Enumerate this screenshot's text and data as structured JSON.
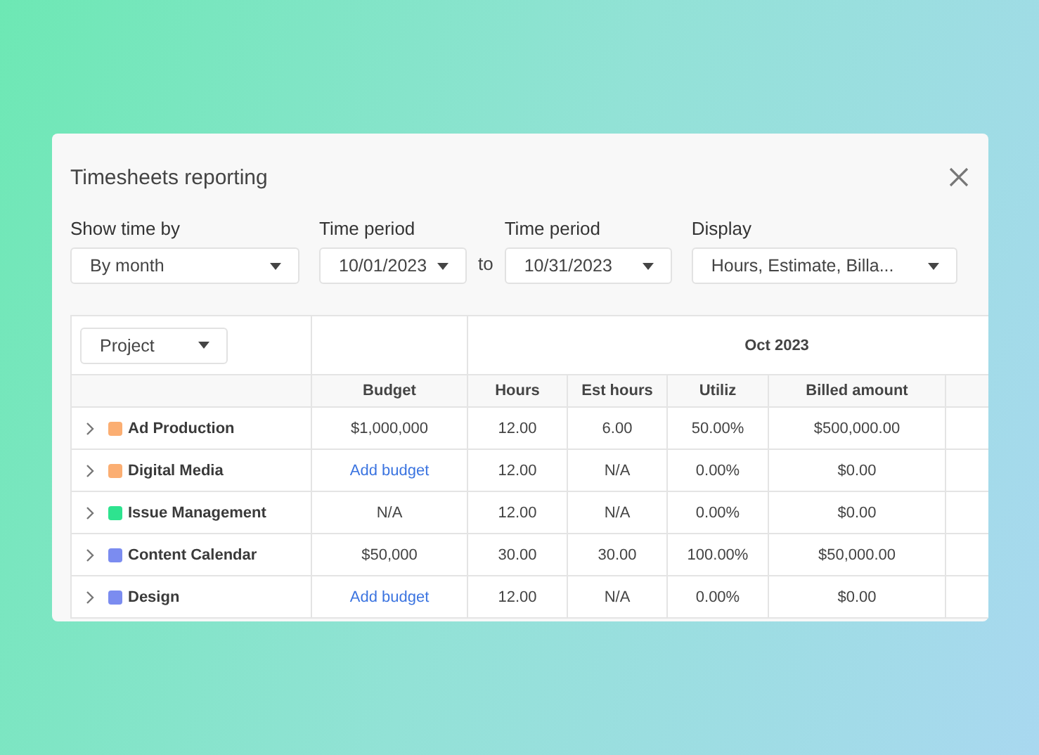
{
  "dialog": {
    "title": "Timesheets reporting"
  },
  "filters": [
    {
      "label": "Show time by",
      "value": "By month"
    },
    {
      "label": "Time period",
      "value": "10/01/2023"
    },
    {
      "separator": "to"
    },
    {
      "label": "Time period",
      "value": "10/31/2023"
    },
    {
      "label": "Display",
      "value": "Hours, Estimate, Billa..."
    }
  ],
  "table": {
    "group_by": "Project",
    "period": "Oct 2023",
    "columns": [
      "Budget",
      "Hours",
      "Est hours",
      "Utiliz",
      "Billed amount"
    ],
    "rows": [
      {
        "name": "Ad Production",
        "color": "#fbae72",
        "budget": {
          "kind": "text",
          "text": "$1,000,000"
        },
        "hours": "12.00",
        "est_hours": "6.00",
        "utiliz": "50.00%",
        "billed": "$500,000.00"
      },
      {
        "name": "Digital Media",
        "color": "#fbae72",
        "budget": {
          "kind": "link",
          "text": "Add budget"
        },
        "hours": "12.00",
        "est_hours": "N/A",
        "utiliz": "0.00%",
        "billed": "$0.00"
      },
      {
        "name": "Issue Management",
        "color": "#2ee38f",
        "budget": {
          "kind": "text",
          "text": "N/A"
        },
        "hours": "12.00",
        "est_hours": "N/A",
        "utiliz": "0.00%",
        "billed": "$0.00"
      },
      {
        "name": "Content Calendar",
        "color": "#7b8cf0",
        "budget": {
          "kind": "text",
          "text": "$50,000"
        },
        "hours": "30.00",
        "est_hours": "30.00",
        "utiliz": "100.00%",
        "billed": "$50,000.00"
      },
      {
        "name": "Design",
        "color": "#7b8cf0",
        "budget": {
          "kind": "link",
          "text": "Add budget"
        },
        "hours": "12.00",
        "est_hours": "N/A",
        "utiliz": "0.00%",
        "billed": "$0.00"
      }
    ]
  }
}
